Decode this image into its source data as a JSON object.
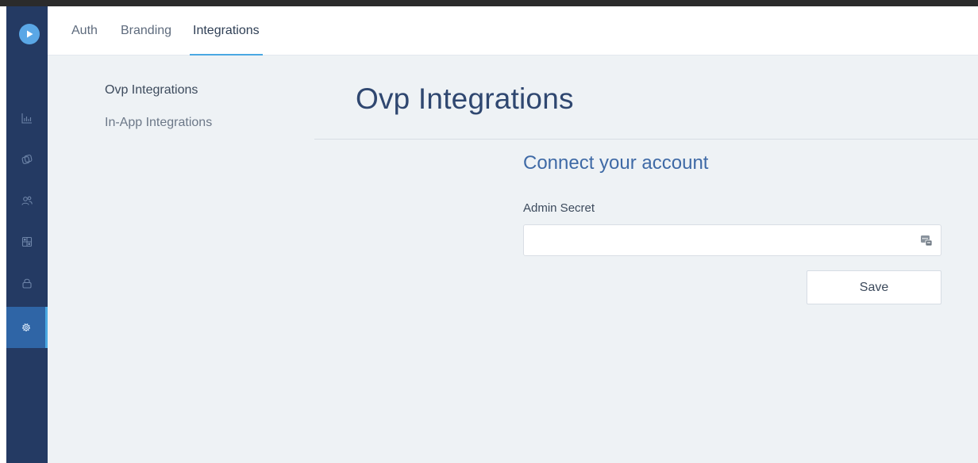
{
  "tabs": [
    {
      "label": "Auth",
      "active": false
    },
    {
      "label": "Branding",
      "active": false
    },
    {
      "label": "Integrations",
      "active": true
    }
  ],
  "sidebar": {
    "logo_icon": "play-icon",
    "items": [
      {
        "icon": "bar-chart-icon",
        "active": false
      },
      {
        "icon": "stacked-cards-icon",
        "active": false
      },
      {
        "icon": "users-icon",
        "active": false
      },
      {
        "icon": "grid-panel-icon",
        "active": false
      },
      {
        "icon": "lock-icon",
        "active": false
      },
      {
        "icon": "gear-icon",
        "active": true
      }
    ]
  },
  "subnav": {
    "items": [
      {
        "label": "Ovp Integrations",
        "active": true
      },
      {
        "label": "In-App Integrations",
        "active": false
      }
    ]
  },
  "main": {
    "title": "Ovp Integrations",
    "section_title": "Connect your account",
    "admin_secret": {
      "label": "Admin Secret",
      "value": "",
      "placeholder": "",
      "icon": "password-manager-icon"
    },
    "save_label": "Save"
  },
  "colors": {
    "sidebar_bg": "#243a63",
    "sidebar_active": "#2f65a6",
    "accent": "#4aa8e2",
    "title": "#2f4770",
    "section_title": "#3f6aa6",
    "content_bg": "#eef2f5"
  }
}
